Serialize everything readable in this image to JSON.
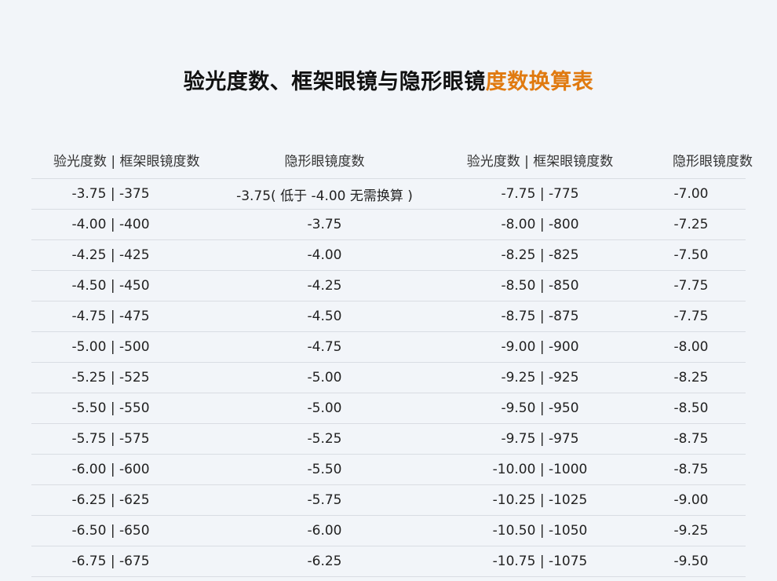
{
  "title": {
    "main": "验光度数、框架眼镜与隐形眼镜",
    "highlight": "度数换算表"
  },
  "colors": {
    "highlight": "#e07a10",
    "background": "#f2f5f9"
  },
  "table": {
    "headers": [
      "验光度数 | 框架眼镜度数",
      "隐形眼镜度数",
      "验光度数 | 框架眼镜度数",
      "隐形眼镜度数"
    ],
    "rows": [
      [
        "-3.75 | -375",
        "-3.75( 低于 -4.00 无需换算 )",
        "-7.75 | -775",
        "-7.00"
      ],
      [
        "-4.00 | -400",
        "-3.75",
        "-8.00 | -800",
        "-7.25"
      ],
      [
        "-4.25 | -425",
        "-4.00",
        "-8.25 | -825",
        "-7.50"
      ],
      [
        "-4.50 | -450",
        "-4.25",
        "-8.50 | -850",
        "-7.75"
      ],
      [
        "-4.75 | -475",
        "-4.50",
        "-8.75 | -875",
        "-7.75"
      ],
      [
        "-5.00 | -500",
        "-4.75",
        "-9.00 | -900",
        "-8.00"
      ],
      [
        "-5.25 | -525",
        "-5.00",
        "-9.25 | -925",
        "-8.25"
      ],
      [
        "-5.50 | -550",
        "-5.00",
        "-9.50 | -950",
        "-8.50"
      ],
      [
        "-5.75 | -575",
        "-5.25",
        "-9.75 | -975",
        "-8.75"
      ],
      [
        "-6.00 | -600",
        "-5.50",
        "-10.00 | -1000",
        "-8.75"
      ],
      [
        "-6.25 | -625",
        "-5.75",
        "-10.25 | -1025",
        "-9.00"
      ],
      [
        "-6.50 | -650",
        "-6.00",
        "-10.50 | -1050",
        "-9.25"
      ],
      [
        "-6.75 | -675",
        "-6.25",
        "-10.75 | -1075",
        "-9.50"
      ]
    ]
  }
}
